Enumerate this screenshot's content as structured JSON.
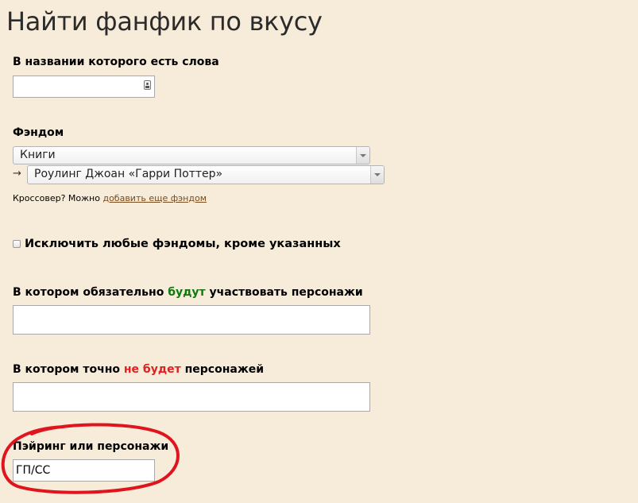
{
  "header": {
    "title": "Найти фанфик по вкусу"
  },
  "title_words": {
    "label": "В названии которого есть слова",
    "value": "",
    "icon": "key-icon"
  },
  "fandom": {
    "label": "Фэндом",
    "category_selected": "Книги",
    "arrow": "→",
    "fandom_selected": "Роулинг Джоан «Гарри Поттер»",
    "crossover_prefix": "Кроссовер? Можно ",
    "crossover_link": "добавить еще фэндом"
  },
  "exclude_other": {
    "label": "Исключить любые фэндомы, кроме указанных",
    "checked": false
  },
  "characters_included": {
    "label_before": "В котором обязательно ",
    "label_highlight": "будут",
    "label_after": " участвовать персонажи",
    "highlight_color": "#0c7a0c",
    "value": ""
  },
  "characters_excluded": {
    "label_before": "В котором точно ",
    "label_highlight": "не будет",
    "label_after": " персонажей",
    "highlight_color": "#e02020",
    "value": ""
  },
  "pairing": {
    "label": "Пэйринг или персонажи",
    "value": "ГП/СС",
    "annotation_color": "#e0141e"
  }
}
